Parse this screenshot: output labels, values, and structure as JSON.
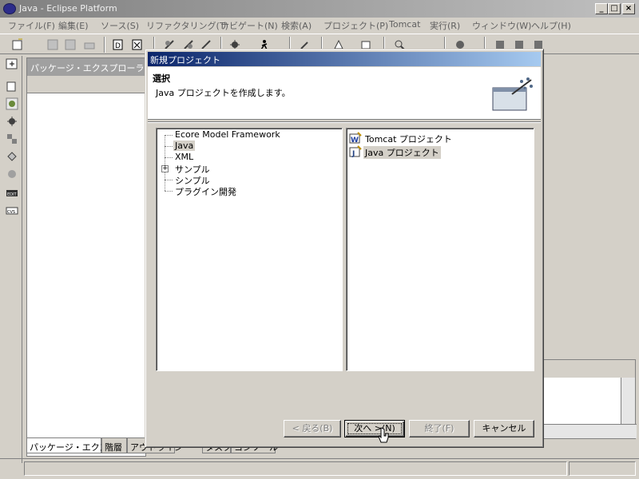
{
  "window": {
    "title": "Java - Eclipse Platform"
  },
  "menu": [
    "ファイル(F)",
    "編集(E)",
    "ソース(S)",
    "リファクタリング(T)",
    "ナビゲート(N)",
    "検索(A)",
    "プロジェクト(P)",
    "Tomcat",
    "実行(R)",
    "ウィンドウ(W)",
    "ヘルプ(H)"
  ],
  "views": {
    "package_explorer_title": "パッケージ・エクスプローラー",
    "tabs": [
      "パッケージ・エクス...",
      "階層",
      "アウトライン",
      "タスク",
      "コンソール"
    ]
  },
  "dialog": {
    "title": "新規プロジェクト",
    "heading": "選択",
    "message": "Java プロジェクトを作成します。",
    "tree": [
      "Ecore Model Framework",
      "Java",
      "XML",
      "サンプル",
      "シンプル",
      "プラグイン開発"
    ],
    "tree_selected": "Java",
    "wizards": [
      "Tomcat プロジェクト",
      "Java プロジェクト"
    ],
    "wizard_selected": "Java プロジェクト",
    "buttons": {
      "back": "< 戻る(B)",
      "next": "次へ >(N)",
      "finish": "終了(F)",
      "cancel": "キャンセル"
    }
  },
  "colors": {
    "titlebar_active": "#0a246a",
    "titlebar_inactive": "#808080",
    "face": "#d4d0c8"
  }
}
